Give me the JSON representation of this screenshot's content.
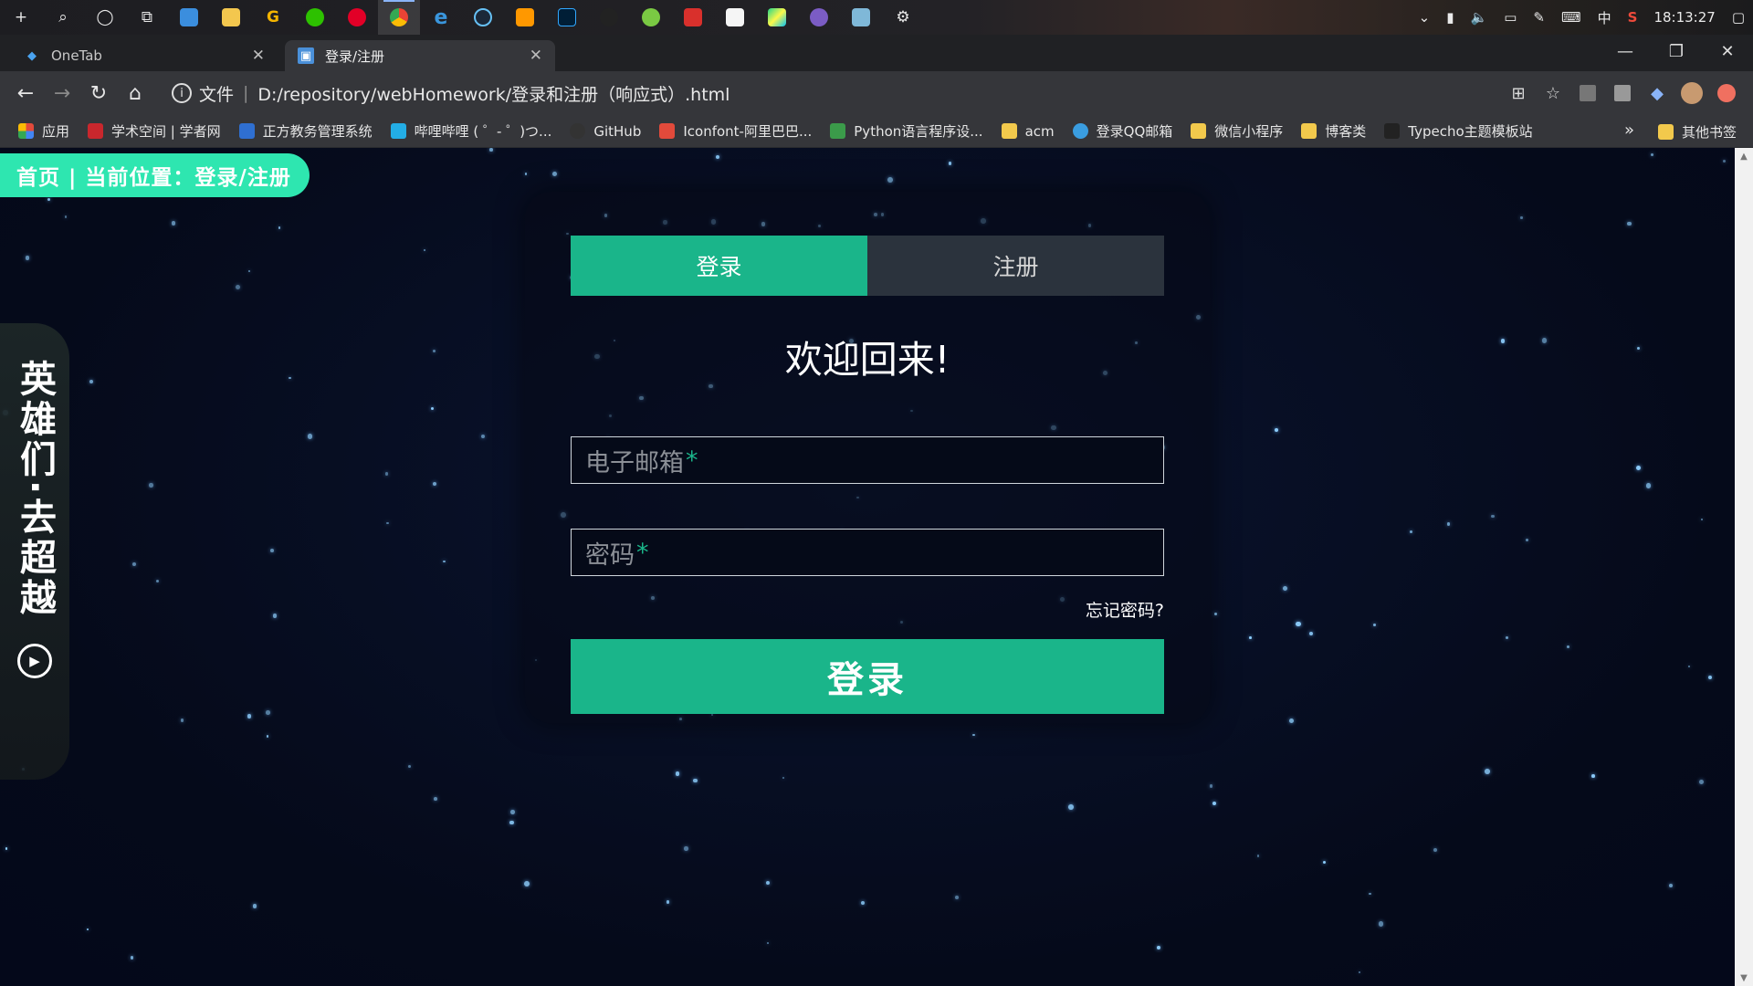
{
  "taskbar": {
    "icons": [
      "add-icon",
      "search-icon",
      "cortana-icon",
      "task-view-icon",
      "pc-icon",
      "folder-icon",
      "g-app-icon",
      "wechat-icon",
      "netease-music-icon",
      "chrome-icon",
      "edge-icon",
      "steam-icon",
      "sublime-icon",
      "photoshop-icon",
      "qq-icon",
      "tortoise-icon",
      "app-red-icon",
      "app-white-icon",
      "pycharm-icon",
      "app-purple-icon",
      "app-blue-icon",
      "settings-icon"
    ],
    "input_method": "中",
    "time": "18:13:27"
  },
  "tabs": [
    {
      "title": "OneTab",
      "active": false
    },
    {
      "title": "登录/注册",
      "active": true
    }
  ],
  "omnibox": {
    "scheme_label": "文件",
    "url": "D:/repository/webHomework/登录和注册（响应式）.html"
  },
  "bookmarks": [
    {
      "label": "应用",
      "color": "#e24a3b"
    },
    {
      "label": "学术空间 | 学者网",
      "color": "#c9272d"
    },
    {
      "label": "正方教务管理系统",
      "color": "#2f6fd1"
    },
    {
      "label": "哔哩哔哩 ( ゜- ゜)つ...",
      "color": "#23ade5"
    },
    {
      "label": "GitHub",
      "color": "#333333"
    },
    {
      "label": "Iconfont-阿里巴巴...",
      "color": "#e24a3b"
    },
    {
      "label": "Python语言程序设...",
      "color": "#3b9b4a"
    },
    {
      "label": "acm",
      "color": "#f2c94c"
    },
    {
      "label": "登录QQ邮箱",
      "color": "#3a9de0"
    },
    {
      "label": "微信小程序",
      "color": "#f2c94c"
    },
    {
      "label": "博客类",
      "color": "#f2c94c"
    },
    {
      "label": "Typecho主题模板站",
      "color": "#222222"
    }
  ],
  "bookmarks_more": "»",
  "other_bookmarks": "其他书签",
  "page": {
    "breadcrumb": "首页 | 当前位置：登录/注册",
    "sidebar_text": "英雄们·去超越",
    "tab_login": "登录",
    "tab_register": "注册",
    "welcome": "欢迎回来!",
    "email_placeholder": "电子邮箱",
    "password_placeholder": "密码",
    "required_mark": "*",
    "forgot": "忘记密码?",
    "submit": "登录"
  },
  "colors": {
    "accent": "#1ab58a",
    "breadcrumb_bg": "#2ee6b0",
    "background": "#060b1c"
  }
}
